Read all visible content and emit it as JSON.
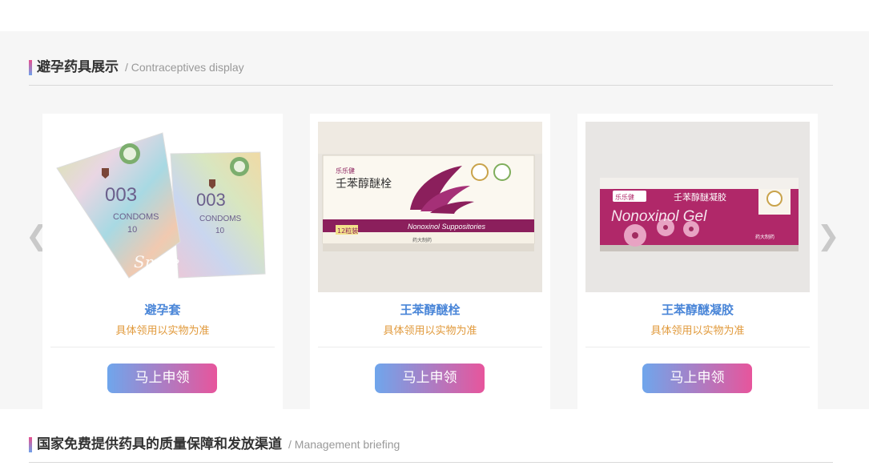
{
  "section1": {
    "title": "避孕药具展示",
    "subtitle": "/ Contraceptives display"
  },
  "section2": {
    "title": "国家免费提供药具的质量保障和发放渠道",
    "subtitle": "/ Management briefing"
  },
  "carousel": {
    "prev_glyph": "❮",
    "next_glyph": "❯"
  },
  "products": [
    {
      "name": "避孕套",
      "note": "具体领用以实物为准",
      "button": "马上申领",
      "box_brand": "003",
      "box_text": "CONDOMS",
      "box_count": "10",
      "box_script": "Smile"
    },
    {
      "name": "王苯醇醚栓",
      "note": "具体领用以实物为准",
      "button": "马上申领",
      "box_brand": "乐乐健",
      "box_title": "壬苯醇醚栓",
      "box_english": "Nonoxinol Suppositories",
      "box_count": "12粒装",
      "box_maker": "药大制药"
    },
    {
      "name": "王苯醇醚凝胶",
      "note": "具体领用以实物为准",
      "button": "马上申领",
      "box_brand": "乐乐健",
      "box_title": "壬苯醇醚凝胶",
      "box_english": "Nonoxinol Gel",
      "box_maker": "药大制药"
    }
  ],
  "colors": {
    "title_blue": "#4a86d8",
    "note_orange": "#e19a3c",
    "btn_start": "#6fa6ec",
    "btn_end": "#e7559c"
  }
}
